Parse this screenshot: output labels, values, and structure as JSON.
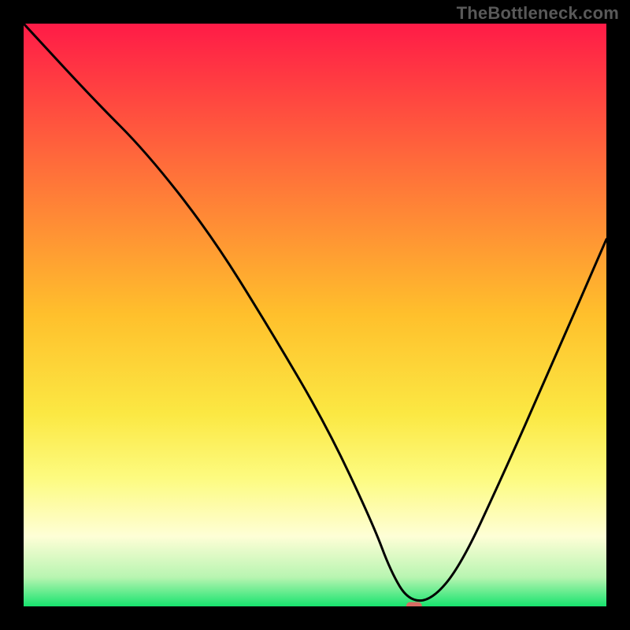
{
  "watermark": "TheBottleneck.com",
  "chart_data": {
    "type": "line",
    "title": "",
    "xlabel": "",
    "ylabel": "",
    "xlim": [
      0,
      100
    ],
    "ylim": [
      0,
      100
    ],
    "grid": false,
    "legend": false,
    "marker": {
      "x": 67,
      "y": 0,
      "color": "#d86b63"
    },
    "background_gradient": {
      "stops": [
        {
          "offset": 0,
          "color": "#ff1b47"
        },
        {
          "offset": 25,
          "color": "#ff6f3a"
        },
        {
          "offset": 50,
          "color": "#ffc02c"
        },
        {
          "offset": 67,
          "color": "#fbe843"
        },
        {
          "offset": 78,
          "color": "#fdfb80"
        },
        {
          "offset": 88,
          "color": "#fefed6"
        },
        {
          "offset": 95,
          "color": "#b8f5b1"
        },
        {
          "offset": 100,
          "color": "#17e36e"
        }
      ]
    },
    "series": [
      {
        "name": "bottleneck-curve",
        "x": [
          0,
          12,
          21,
          32,
          42,
          52,
          60,
          63,
          66,
          70,
          75,
          82,
          90,
          100
        ],
        "values": [
          100,
          87,
          78,
          64,
          48,
          31,
          14,
          6,
          1,
          1,
          7,
          22,
          40,
          63
        ]
      }
    ]
  }
}
